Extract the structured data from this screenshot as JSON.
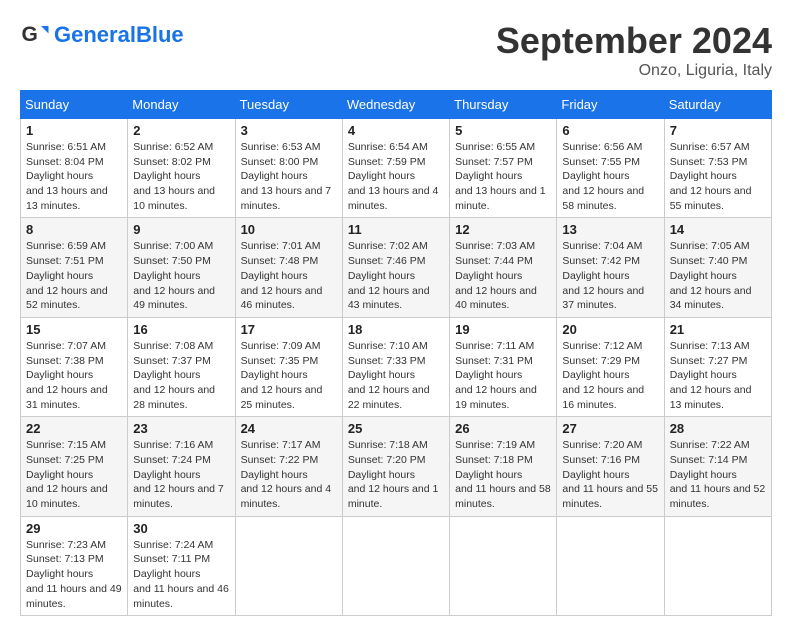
{
  "header": {
    "logo_text_general": "General",
    "logo_text_blue": "Blue",
    "month_title": "September 2024",
    "location": "Onzo, Liguria, Italy"
  },
  "days_of_week": [
    "Sunday",
    "Monday",
    "Tuesday",
    "Wednesday",
    "Thursday",
    "Friday",
    "Saturday"
  ],
  "weeks": [
    [
      {
        "day": "1",
        "sunrise": "6:51 AM",
        "sunset": "8:04 PM",
        "daylight": "13 hours and 13 minutes."
      },
      {
        "day": "2",
        "sunrise": "6:52 AM",
        "sunset": "8:02 PM",
        "daylight": "13 hours and 10 minutes."
      },
      {
        "day": "3",
        "sunrise": "6:53 AM",
        "sunset": "8:00 PM",
        "daylight": "13 hours and 7 minutes."
      },
      {
        "day": "4",
        "sunrise": "6:54 AM",
        "sunset": "7:59 PM",
        "daylight": "13 hours and 4 minutes."
      },
      {
        "day": "5",
        "sunrise": "6:55 AM",
        "sunset": "7:57 PM",
        "daylight": "13 hours and 1 minute."
      },
      {
        "day": "6",
        "sunrise": "6:56 AM",
        "sunset": "7:55 PM",
        "daylight": "12 hours and 58 minutes."
      },
      {
        "day": "7",
        "sunrise": "6:57 AM",
        "sunset": "7:53 PM",
        "daylight": "12 hours and 55 minutes."
      }
    ],
    [
      {
        "day": "8",
        "sunrise": "6:59 AM",
        "sunset": "7:51 PM",
        "daylight": "12 hours and 52 minutes."
      },
      {
        "day": "9",
        "sunrise": "7:00 AM",
        "sunset": "7:50 PM",
        "daylight": "12 hours and 49 minutes."
      },
      {
        "day": "10",
        "sunrise": "7:01 AM",
        "sunset": "7:48 PM",
        "daylight": "12 hours and 46 minutes."
      },
      {
        "day": "11",
        "sunrise": "7:02 AM",
        "sunset": "7:46 PM",
        "daylight": "12 hours and 43 minutes."
      },
      {
        "day": "12",
        "sunrise": "7:03 AM",
        "sunset": "7:44 PM",
        "daylight": "12 hours and 40 minutes."
      },
      {
        "day": "13",
        "sunrise": "7:04 AM",
        "sunset": "7:42 PM",
        "daylight": "12 hours and 37 minutes."
      },
      {
        "day": "14",
        "sunrise": "7:05 AM",
        "sunset": "7:40 PM",
        "daylight": "12 hours and 34 minutes."
      }
    ],
    [
      {
        "day": "15",
        "sunrise": "7:07 AM",
        "sunset": "7:38 PM",
        "daylight": "12 hours and 31 minutes."
      },
      {
        "day": "16",
        "sunrise": "7:08 AM",
        "sunset": "7:37 PM",
        "daylight": "12 hours and 28 minutes."
      },
      {
        "day": "17",
        "sunrise": "7:09 AM",
        "sunset": "7:35 PM",
        "daylight": "12 hours and 25 minutes."
      },
      {
        "day": "18",
        "sunrise": "7:10 AM",
        "sunset": "7:33 PM",
        "daylight": "12 hours and 22 minutes."
      },
      {
        "day": "19",
        "sunrise": "7:11 AM",
        "sunset": "7:31 PM",
        "daylight": "12 hours and 19 minutes."
      },
      {
        "day": "20",
        "sunrise": "7:12 AM",
        "sunset": "7:29 PM",
        "daylight": "12 hours and 16 minutes."
      },
      {
        "day": "21",
        "sunrise": "7:13 AM",
        "sunset": "7:27 PM",
        "daylight": "12 hours and 13 minutes."
      }
    ],
    [
      {
        "day": "22",
        "sunrise": "7:15 AM",
        "sunset": "7:25 PM",
        "daylight": "12 hours and 10 minutes."
      },
      {
        "day": "23",
        "sunrise": "7:16 AM",
        "sunset": "7:24 PM",
        "daylight": "12 hours and 7 minutes."
      },
      {
        "day": "24",
        "sunrise": "7:17 AM",
        "sunset": "7:22 PM",
        "daylight": "12 hours and 4 minutes."
      },
      {
        "day": "25",
        "sunrise": "7:18 AM",
        "sunset": "7:20 PM",
        "daylight": "12 hours and 1 minute."
      },
      {
        "day": "26",
        "sunrise": "7:19 AM",
        "sunset": "7:18 PM",
        "daylight": "11 hours and 58 minutes."
      },
      {
        "day": "27",
        "sunrise": "7:20 AM",
        "sunset": "7:16 PM",
        "daylight": "11 hours and 55 minutes."
      },
      {
        "day": "28",
        "sunrise": "7:22 AM",
        "sunset": "7:14 PM",
        "daylight": "11 hours and 52 minutes."
      }
    ],
    [
      {
        "day": "29",
        "sunrise": "7:23 AM",
        "sunset": "7:13 PM",
        "daylight": "11 hours and 49 minutes."
      },
      {
        "day": "30",
        "sunrise": "7:24 AM",
        "sunset": "7:11 PM",
        "daylight": "11 hours and 46 minutes."
      },
      null,
      null,
      null,
      null,
      null
    ]
  ]
}
